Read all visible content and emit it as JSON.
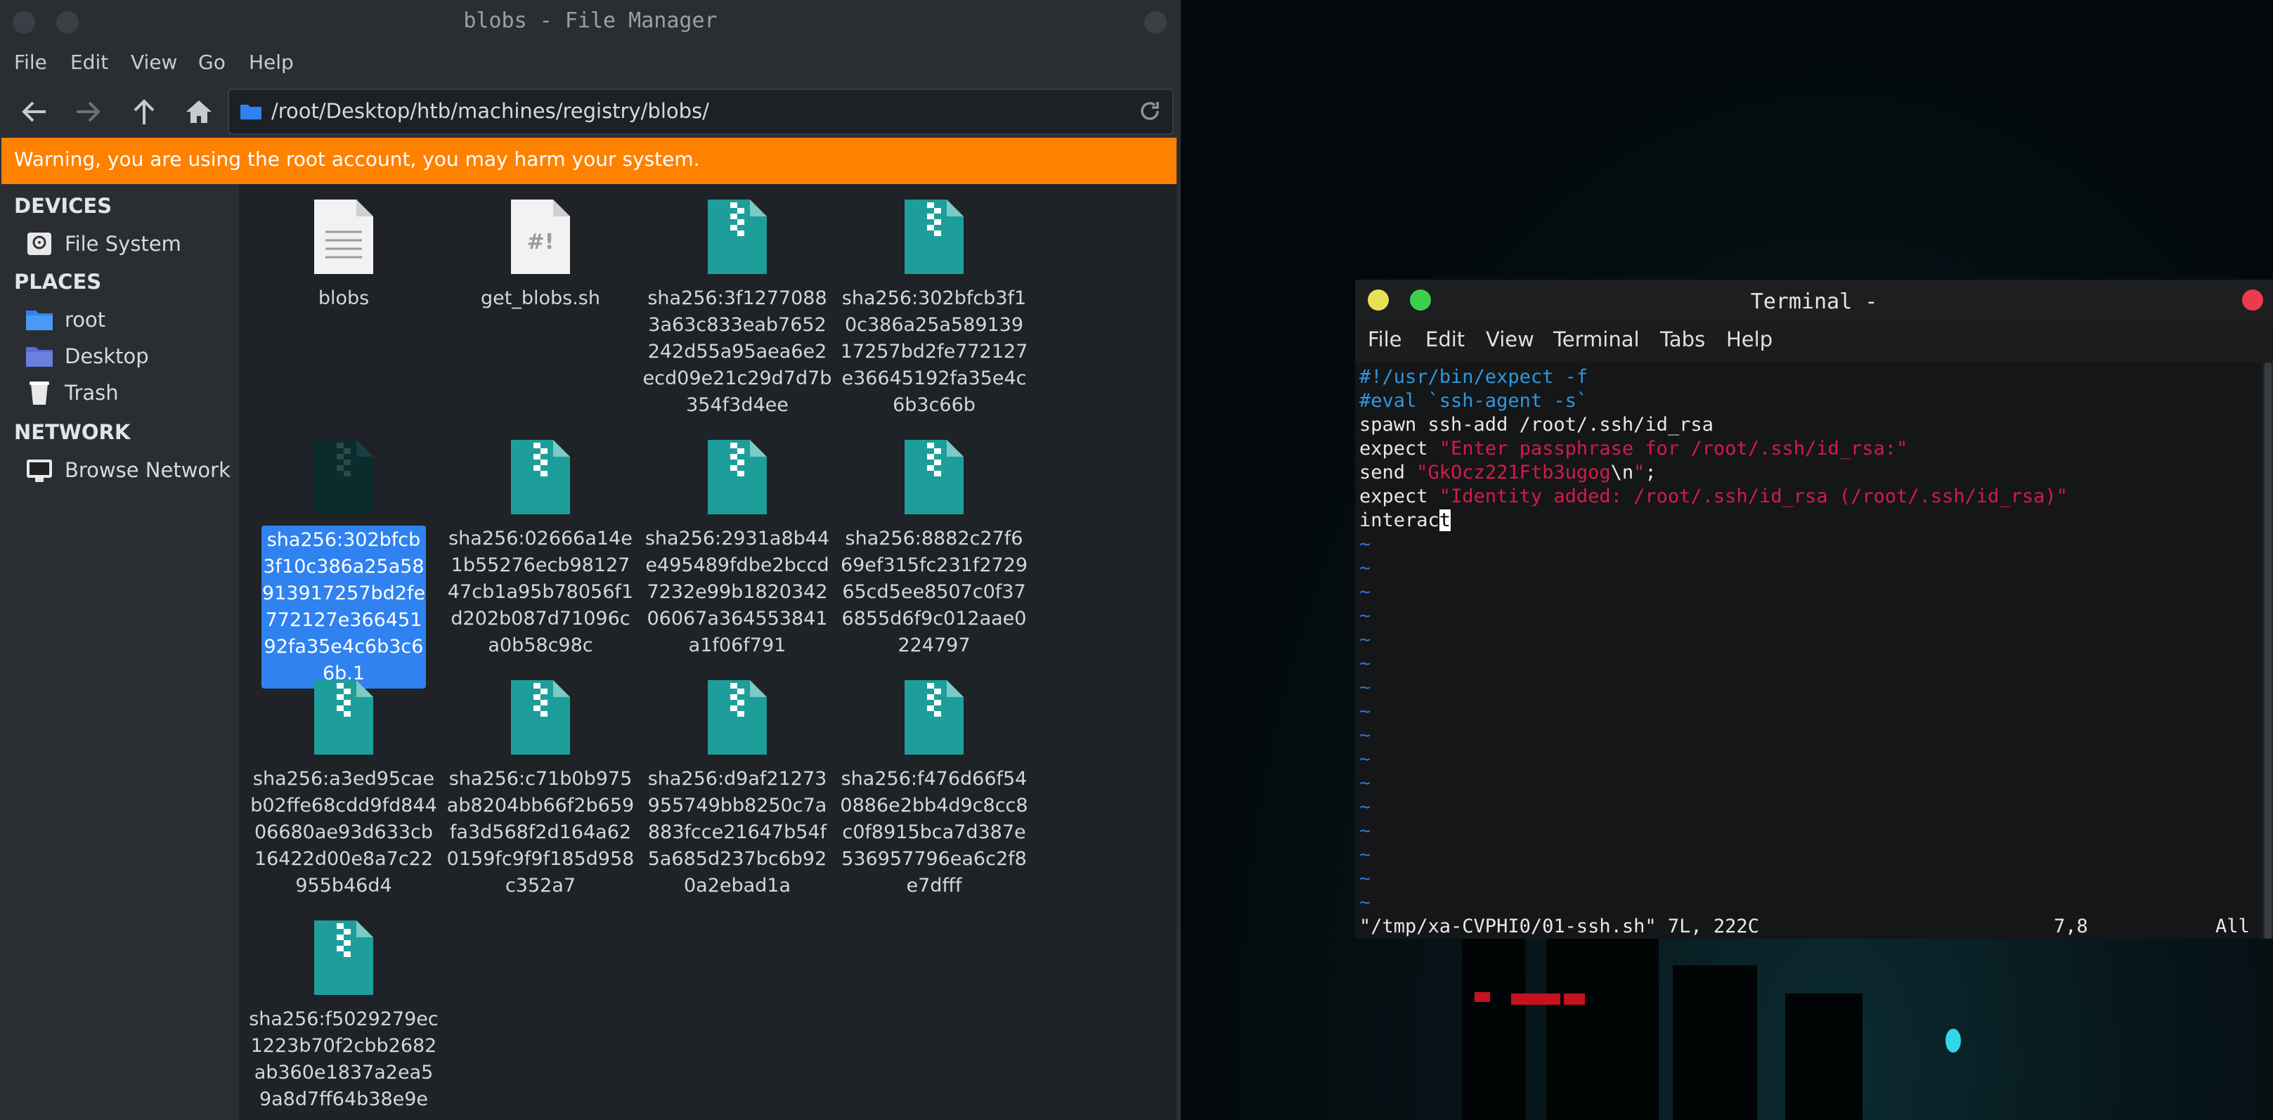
{
  "file_manager": {
    "title": "blobs - File Manager",
    "menu": [
      "File",
      "Edit",
      "View",
      "Go",
      "Help"
    ],
    "path": "/root/Desktop/htb/machines/registry/blobs/",
    "warning": "Warning, you are using the root account, you may harm your system.",
    "sidebar": {
      "devices_heading": "DEVICES",
      "devices": [
        {
          "label": "File System",
          "icon": "hard-drive-icon"
        }
      ],
      "places_heading": "PLACES",
      "places": [
        {
          "label": "root",
          "icon": "home-folder-icon"
        },
        {
          "label": "Desktop",
          "icon": "desktop-folder-icon"
        },
        {
          "label": "Trash",
          "icon": "trash-icon"
        }
      ],
      "network_heading": "NETWORK",
      "network": [
        {
          "label": "Browse Network",
          "icon": "network-icon"
        }
      ]
    },
    "files": [
      {
        "name": "blobs",
        "type": "text",
        "selected": false
      },
      {
        "name": "get_blobs.sh",
        "type": "script",
        "selected": false
      },
      {
        "name": "sha256:3f12770883a63c833eab7652242d55a95aea6e2ecd09e21c29d7d7b354f3d4ee",
        "type": "archive",
        "selected": false
      },
      {
        "name": "sha256:302bfcb3f10c386a25a58913917257bd2fe772127e36645192fa35e4c6b3c66b",
        "type": "archive",
        "selected": false
      },
      {
        "name": "sha256:302bfcb3f10c386a25a58913917257bd2fe772127e36645192fa35e4c6b3c66b.1",
        "type": "archive-dark",
        "selected": true
      },
      {
        "name": "sha256:02666a14e1b55276ecb9812747cb1a95b78056f1d202b087d71096ca0b58c98c",
        "type": "archive",
        "selected": false
      },
      {
        "name": "sha256:2931a8b44e495489fdbe2bccd7232e99b182034206067a364553841a1f06f791",
        "type": "archive",
        "selected": false
      },
      {
        "name": "sha256:8882c27f669ef315fc231f272965cd5ee8507c0f376855d6f9c012aae0224797",
        "type": "archive",
        "selected": false
      },
      {
        "name": "sha256:a3ed95caeb02ffe68cdd9fd84406680ae93d633cb16422d00e8a7c22955b46d4",
        "type": "archive",
        "selected": false
      },
      {
        "name": "sha256:c71b0b975ab8204bb66f2b659fa3d568f2d164a620159fc9f9f185d958c352a7",
        "type": "archive",
        "selected": false
      },
      {
        "name": "sha256:d9af21273955749bb8250c7a883fcce21647b54f5a685d237bc6b920a2ebad1a",
        "type": "archive",
        "selected": false
      },
      {
        "name": "sha256:f476d66f540886e2bb4d9c8cc8c0f8915bca7d387e536957796ea6c2f8e7dfff",
        "type": "archive",
        "selected": false
      },
      {
        "name": "sha256:f5029279ec1223b70f2cbb2682ab360e1837a2ea59a8d7ff64b38e9e",
        "type": "archive",
        "selected": false
      }
    ]
  },
  "terminal": {
    "title": "Terminal -",
    "menu": [
      "File",
      "Edit",
      "View",
      "Terminal",
      "Tabs",
      "Help"
    ],
    "lines": [
      {
        "parts": [
          {
            "t": "#!/usr/bin/expect -f",
            "c": "blue"
          }
        ]
      },
      {
        "parts": [
          {
            "t": "#eval `ssh-agent -s`",
            "c": "blue"
          }
        ]
      },
      {
        "parts": [
          {
            "t": "spawn ssh-add /root/.ssh/id_rsa",
            "c": ""
          }
        ]
      },
      {
        "parts": [
          {
            "t": "expect ",
            "c": ""
          },
          {
            "t": "\"Enter passphrase for /root/.ssh/id_rsa:\"",
            "c": "red"
          }
        ]
      },
      {
        "parts": [
          {
            "t": "send ",
            "c": ""
          },
          {
            "t": "\"GkOcz221Ftb3ugog",
            "c": "red"
          },
          {
            "t": "\\n",
            "c": ""
          },
          {
            "t": "\"",
            "c": "red"
          },
          {
            "t": ";",
            "c": ""
          }
        ]
      },
      {
        "parts": [
          {
            "t": "expect ",
            "c": ""
          },
          {
            "t": "\"Identity added: /root/.ssh/id_rsa (/root/.ssh/id_rsa)\"",
            "c": "red"
          }
        ]
      },
      {
        "parts": [
          {
            "t": "interac",
            "c": ""
          },
          {
            "t": "t",
            "c": "cursor"
          }
        ]
      }
    ],
    "tilde_count": 16,
    "tilde_char": "~",
    "status_file": "\"/tmp/xa-CVPHI0/01-ssh.sh\" 7L, 222C",
    "status_pos": "7,8",
    "status_scroll": "All",
    "colors": {
      "keyword_blue": "#2f97e0",
      "string_red": "#d61a4a",
      "tilde_blue": "#2f74d0"
    }
  },
  "colors": {
    "warning_bg": "#ff8100",
    "selection": "#2f82f0",
    "archive_icon": "#1e9e9a"
  }
}
